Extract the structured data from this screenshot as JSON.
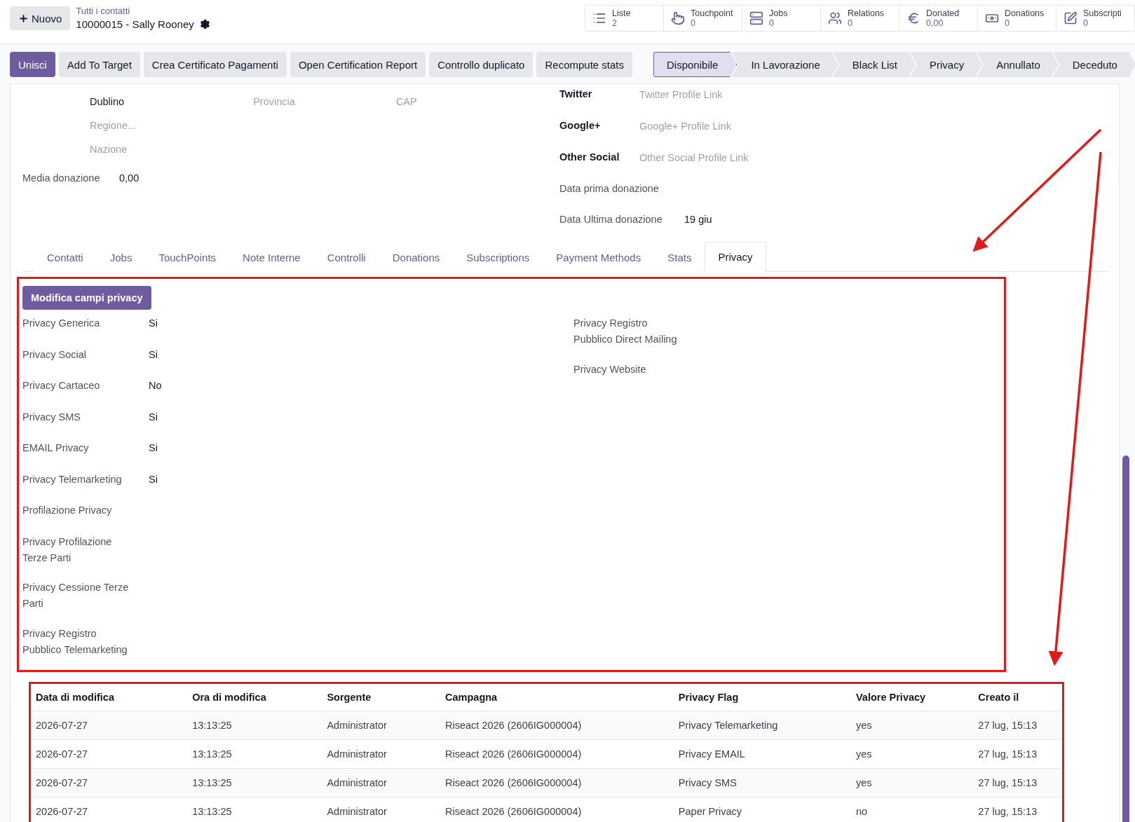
{
  "header": {
    "new_button": "Nuovo",
    "breadcrumb": "Tutti i contatti",
    "record_title": "10000015 - Sally Rooney"
  },
  "stat_buttons": [
    {
      "kind": "list",
      "label": "Liste",
      "value": "2"
    },
    {
      "kind": "touch",
      "label": "Touchpoint",
      "value": "0"
    },
    {
      "kind": "jobs",
      "label": "Jobs",
      "value": "0"
    },
    {
      "kind": "people",
      "label": "Relations",
      "value": "0"
    },
    {
      "kind": "euro",
      "label": "Donated",
      "value": "0,00"
    },
    {
      "kind": "money",
      "label": "Donations",
      "value": "0"
    },
    {
      "kind": "edit",
      "label": "Subscripti",
      "value": "0"
    }
  ],
  "actions": [
    {
      "label": "Unisci",
      "primary": true
    },
    {
      "label": "Add To Target",
      "primary": false
    },
    {
      "label": "Crea Certificato Pagamenti",
      "primary": false
    },
    {
      "label": "Open Certification Report",
      "primary": false
    },
    {
      "label": "Controllo duplicato",
      "primary": false
    },
    {
      "label": "Recompute stats",
      "primary": false
    }
  ],
  "stages": [
    {
      "label": "Disponibile",
      "selected": true
    },
    {
      "label": "In Lavorazione",
      "selected": false
    },
    {
      "label": "Black List",
      "selected": false
    },
    {
      "label": "Privacy",
      "selected": false
    },
    {
      "label": "Annullato",
      "selected": false
    },
    {
      "label": "Deceduto",
      "selected": false
    }
  ],
  "address": {
    "city": "Dublino",
    "province_placeholder": "Provincia",
    "zip_placeholder": "CAP",
    "region_placeholder": "Regione...",
    "country_placeholder": "Nazione"
  },
  "media_donazione": {
    "label": "Media donazione",
    "value": "0,00"
  },
  "social": [
    {
      "label": "Twitter",
      "placeholder": "Twitter Profile Link"
    },
    {
      "label": "Google+",
      "placeholder": "Google+ Profile Link"
    },
    {
      "label": "Other Social",
      "placeholder": "Other Social Profile Link"
    }
  ],
  "donation_dates": [
    {
      "label": "Data prima donazione"
    },
    {
      "label": "Data Ultima donazione",
      "value": "19 giu"
    }
  ],
  "tabs": [
    {
      "label": "Contatti",
      "selected": false
    },
    {
      "label": "Jobs",
      "selected": false
    },
    {
      "label": "TouchPoints",
      "selected": false
    },
    {
      "label": "Note Interne",
      "selected": false
    },
    {
      "label": "Controlli",
      "selected": false
    },
    {
      "label": "Donations",
      "selected": false
    },
    {
      "label": "Subscriptions",
      "selected": false
    },
    {
      "label": "Payment Methods",
      "selected": false
    },
    {
      "label": "Stats",
      "selected": false
    },
    {
      "label": "Privacy",
      "selected": true
    }
  ],
  "privacy": {
    "edit_button": "Modifica campi privacy",
    "left_fields": [
      {
        "label": "Privacy Generica",
        "value": "Si"
      },
      {
        "label": "Privacy Social",
        "value": "Si"
      },
      {
        "label": "Privacy Cartaceo",
        "value": "No"
      },
      {
        "label": "Privacy SMS",
        "value": "Si"
      },
      {
        "label": "EMAIL Privacy",
        "value": "Si"
      },
      {
        "label": "Privacy Telemarketing",
        "value": "Si"
      },
      {
        "label": "Profilazione Privacy"
      },
      {
        "label": "Privacy Profilazione Terze Parti"
      },
      {
        "label": "Privacy Cessione Terze Parti"
      },
      {
        "label": "Privacy Registro Pubblico Telemarketing"
      }
    ],
    "right_fields": [
      {
        "label": "Privacy Registro Pubblico Direct Mailing"
      },
      {
        "label": "Privacy Website"
      }
    ]
  },
  "table": {
    "columns": [
      "Data di modifica",
      "Ora di modifica",
      "Sorgente",
      "Campagna",
      "Privacy Flag",
      "Valore Privacy",
      "Creato il"
    ],
    "rows": [
      [
        "2026-07-27",
        "13:13:25",
        "Administrator",
        "Riseact 2026 (2606IG000004)",
        "Privacy Telemarketing",
        "yes",
        "27 lug, 15:13"
      ],
      [
        "2026-07-27",
        "13:13:25",
        "Administrator",
        "Riseact 2026 (2606IG000004)",
        "Privacy EMAIL",
        "yes",
        "27 lug, 15:13"
      ],
      [
        "2026-07-27",
        "13:13:25",
        "Administrator",
        "Riseact 2026 (2606IG000004)",
        "Privacy SMS",
        "yes",
        "27 lug, 15:13"
      ],
      [
        "2026-07-27",
        "13:13:25",
        "Administrator",
        "Riseact 2026 (2606IG000004)",
        "Paper Privacy",
        "no",
        "27 lug, 15:13"
      ]
    ]
  }
}
